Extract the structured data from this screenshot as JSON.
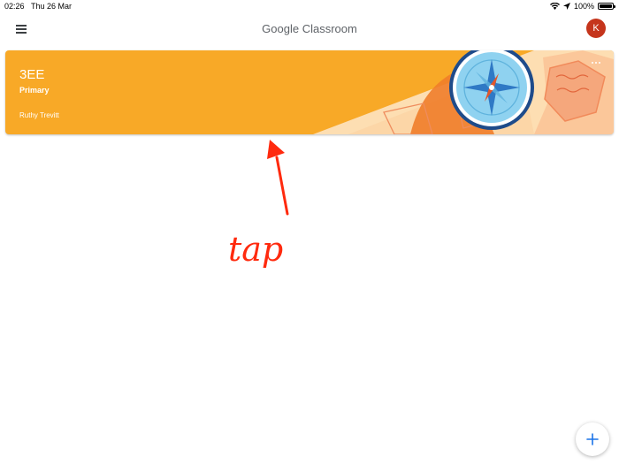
{
  "status_bar": {
    "time": "02:26",
    "date": "Thu 26 Mar",
    "battery": "100%",
    "icons": [
      "wifi-icon",
      "location-arrow-icon",
      "battery-icon"
    ]
  },
  "app_bar": {
    "title": "Google Classroom",
    "menu_icon": "hamburger-menu-icon",
    "avatar_initial": "K",
    "avatar_color": "#c5351c"
  },
  "class_card": {
    "name": "3EE",
    "section": "Primary",
    "teacher": "Ruthy Trevitt",
    "background_color": "#f8a927",
    "theme_illustration": "compass-map-icon",
    "more_icon": "more-horizontal-icon"
  },
  "annotation": {
    "text": "tap",
    "color": "#ff2a0e",
    "arrow_icon": "arrow-up-icon"
  },
  "fab": {
    "icon": "plus-icon",
    "color": "#1a73e8"
  }
}
